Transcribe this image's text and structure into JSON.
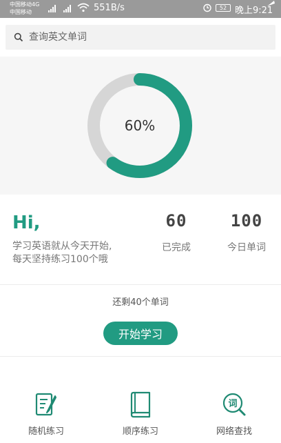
{
  "status_bar": {
    "carrier_primary": "中国移动4G",
    "carrier_secondary": "中国移动",
    "net_speed": "551B/s",
    "battery": "52",
    "time": "晚上9:21"
  },
  "search": {
    "placeholder": "查询英文单词"
  },
  "progress": {
    "percent": 60,
    "label": "60%",
    "colors": {
      "ring_fill": "#219b82",
      "ring_track": "#d6d6d6"
    }
  },
  "greeting": {
    "title": "Hi,",
    "tagline_line1": "学习英语就从今天开始,",
    "tagline_line2": "每天坚持练习100个哦"
  },
  "stats": {
    "completed_value": "60",
    "completed_label": "已完成",
    "today_value": "100",
    "today_label": "今日单词"
  },
  "remaining_text": "还剩40个单词",
  "start_button_label": "开始学习",
  "bottom_nav": {
    "items": [
      {
        "label": "随机练习",
        "icon": "note-pencil-icon"
      },
      {
        "label": "顺序练习",
        "icon": "book-icon"
      },
      {
        "label": "网络查找",
        "icon": "word-search-icon"
      }
    ]
  },
  "theme": {
    "accent": "#219b82"
  }
}
